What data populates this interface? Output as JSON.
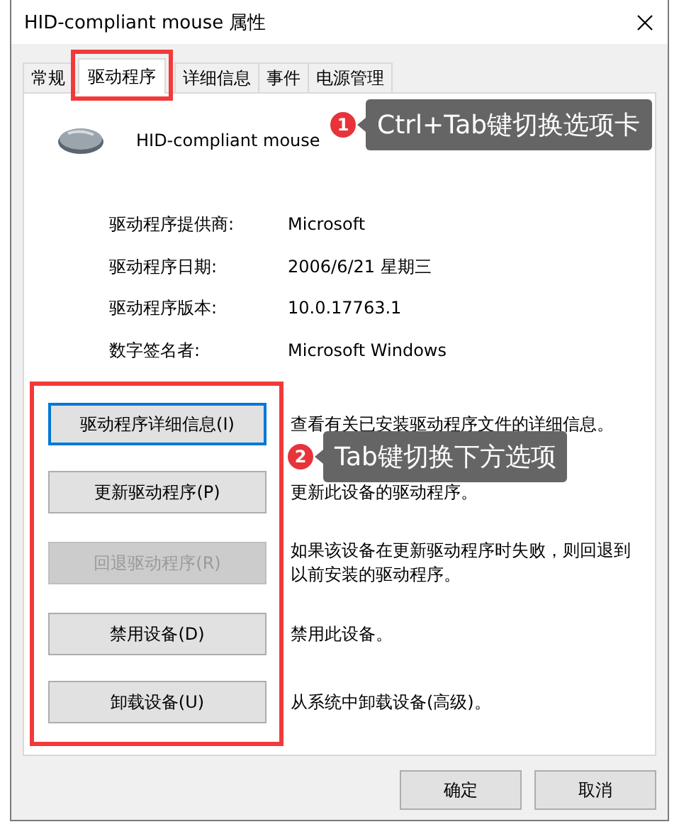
{
  "window": {
    "title": "HID-compliant mouse 属性"
  },
  "tabs": [
    {
      "label": "常规",
      "selected": false
    },
    {
      "label": "驱动程序",
      "selected": true
    },
    {
      "label": "详细信息",
      "selected": false
    },
    {
      "label": "事件",
      "selected": false
    },
    {
      "label": "电源管理",
      "selected": false
    }
  ],
  "device": {
    "name": "HID-compliant mouse"
  },
  "info": [
    {
      "label": "驱动程序提供商:",
      "value": "Microsoft"
    },
    {
      "label": "驱动程序日期:",
      "value": "2006/6/21 星期三"
    },
    {
      "label": "驱动程序版本:",
      "value": "10.0.17763.1"
    },
    {
      "label": "数字签名者:",
      "value": "Microsoft Windows"
    }
  ],
  "actions": [
    {
      "button": "驱动程序详细信息(I)",
      "description": "查看有关已安装驱动程序文件的详细信息。",
      "disabled": false,
      "focused": true
    },
    {
      "button": "更新驱动程序(P)",
      "description": "更新此设备的驱动程序。",
      "disabled": false,
      "focused": false
    },
    {
      "button": "回退驱动程序(R)",
      "description": "如果该设备在更新驱动程序时失败，则回退到以前安装的驱动程序。",
      "disabled": true,
      "focused": false
    },
    {
      "button": "禁用设备(D)",
      "description": "禁用此设备。",
      "disabled": false,
      "focused": false
    },
    {
      "button": "卸载设备(U)",
      "description": "从系统中卸载设备(高级)。",
      "disabled": false,
      "focused": false
    }
  ],
  "footer_buttons": [
    "确定",
    "取消"
  ],
  "annotations": [
    {
      "number": "1",
      "text": "Ctrl+Tab键切换选项卡"
    },
    {
      "number": "2",
      "text": "Tab键切换下方选项"
    }
  ]
}
